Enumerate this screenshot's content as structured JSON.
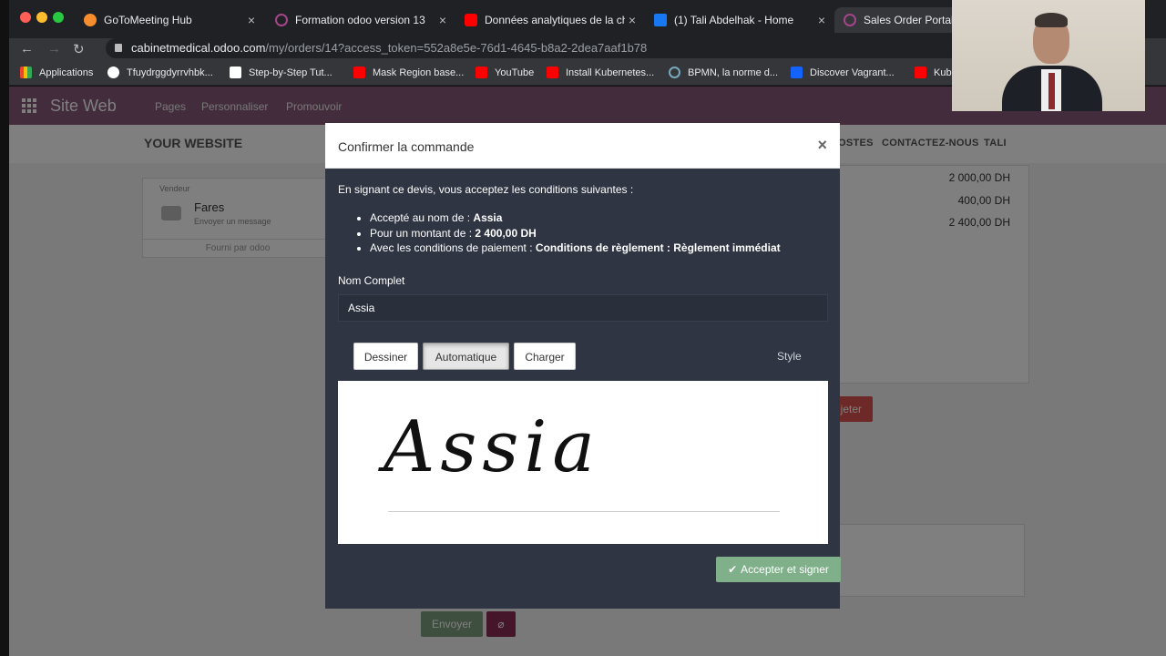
{
  "browser": {
    "tabs": [
      {
        "title": "GoToMeeting Hub",
        "icon_color": "#f68d2e"
      },
      {
        "title": "Formation odoo version 13",
        "icon_color": "#a24689"
      },
      {
        "title": "Données analytiques de la cha",
        "icon_color": "#ff0000"
      },
      {
        "title": "(1) Tali Abdelhak - Home",
        "icon_color": "#1877f2"
      },
      {
        "title": "Sales Order Portal T",
        "icon_color": "#a24689"
      }
    ],
    "url_host": "cabinetmedical.odoo.com",
    "url_path": "/my/orders/14?access_token=552a8e5e-76d1-4645-b8a2-2dea7aaf1b78",
    "bookmarks": [
      {
        "label": "Applications"
      },
      {
        "label": "Tfuydrggdyrrvhbk..."
      },
      {
        "label": "Step-by-Step Tut..."
      },
      {
        "label": "Mask Region base..."
      },
      {
        "label": "YouTube"
      },
      {
        "label": "Install Kubernetes..."
      },
      {
        "label": "BPMN, la norme d..."
      },
      {
        "label": "Discover Vagrant..."
      },
      {
        "label": "Kube"
      }
    ]
  },
  "odoo": {
    "brand": "Site Web",
    "menu": [
      "Pages",
      "Personnaliser",
      "Promouvoir"
    ],
    "logo": "YOUR WEBSITE",
    "header_links": [
      "OSTES",
      "CONTACTEZ-NOUS",
      "TALI"
    ],
    "salesperson_label": "Vendeur",
    "salesperson_name": "Fares",
    "send_message": "Envoyer un message",
    "powered_by": "Fourni par odoo",
    "amounts": [
      "2 000,00 DH",
      "400,00 DH",
      "2 400,00 DH"
    ],
    "refuse_label": "jeter",
    "send_label": "Envoyer"
  },
  "modal": {
    "title": "Confirmer la commande",
    "intro": "En signant ce devis, vous acceptez les conditions suivantes :",
    "terms": {
      "accepted_prefix": "Accepté au nom de :",
      "accepted_name": "Assia",
      "amount_prefix": "Pour un montant de :",
      "amount_value": "2 400,00 DH",
      "payment_prefix": "Avec les conditions de paiement :",
      "payment_value": "Conditions de règlement : Règlement immédiat"
    },
    "name_label": "Nom Complet",
    "name_value": "Assia",
    "sig_buttons": {
      "draw": "Dessiner",
      "auto": "Automatique",
      "load": "Charger"
    },
    "style_label": "Style",
    "signature": "Assia",
    "accept_label": "Accepter et signer"
  }
}
